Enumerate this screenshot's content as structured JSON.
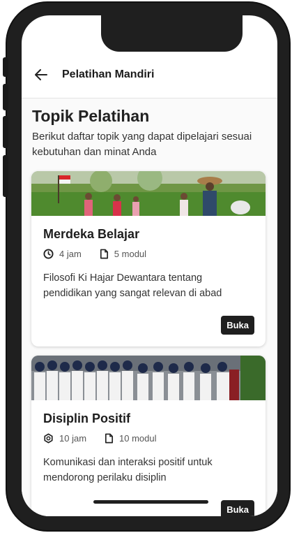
{
  "appbar": {
    "title": "Pelatihan Mandiri",
    "back_icon": "arrow-left-icon"
  },
  "page": {
    "title": "Topik Pelatihan",
    "description": "Berikut daftar topik yang dapat dipelajari sesuai kebutuhan dan minat Anda"
  },
  "cards": [
    {
      "title": "Merdeka Belajar",
      "duration": "4 jam",
      "modules": "5 modul",
      "description": "Filosofi Ki Hajar Dewantara tentang pendidikan yang sangat relevan di abad",
      "button": "Buka",
      "duration_icon": "clock-icon",
      "modules_icon": "document-icon"
    },
    {
      "title": "Disiplin Positif",
      "duration": "10 jam",
      "modules": "10 modul",
      "description": "Komunikasi dan interaksi positif untuk mendorong perilaku disiplin",
      "button": "Buka",
      "duration_icon": "hexagon-icon",
      "modules_icon": "document-icon"
    }
  ],
  "colors": {
    "accent": "#1f1f1f",
    "background": "#fafafa",
    "card": "#ffffff"
  }
}
